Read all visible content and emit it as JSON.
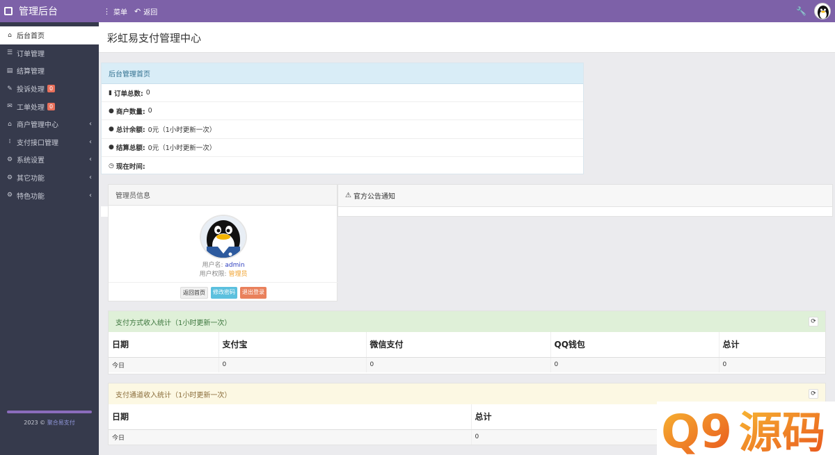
{
  "topbar": {
    "brand": "管理后台",
    "nav": [
      {
        "icon": "⋮",
        "label": "菜单"
      },
      {
        "icon": "↶",
        "label": "返回"
      }
    ]
  },
  "sidebar": {
    "items": [
      {
        "icon": "⌂",
        "label": "后台首页",
        "badge": "",
        "arrow": false
      },
      {
        "icon": "☰",
        "label": "订单管理",
        "badge": "",
        "arrow": false
      },
      {
        "icon": "▤",
        "label": "结算管理",
        "badge": "",
        "arrow": false
      },
      {
        "icon": "✎",
        "label": "投诉处理",
        "badge": "0",
        "arrow": false
      },
      {
        "icon": "✉",
        "label": "工单处理",
        "badge": "0",
        "arrow": false
      },
      {
        "icon": "⌂",
        "label": "商户管理中心",
        "badge": "",
        "arrow": true
      },
      {
        "icon": "⁞",
        "label": "支付接口管理",
        "badge": "",
        "arrow": true
      },
      {
        "icon": "⚙",
        "label": "系统设置",
        "badge": "",
        "arrow": true
      },
      {
        "icon": "⚙",
        "label": "其它功能",
        "badge": "",
        "arrow": true
      },
      {
        "icon": "⚙",
        "label": "特色功能",
        "badge": "",
        "arrow": true
      }
    ],
    "footer_year": "2023 ©",
    "footer_link": "聚合易支付"
  },
  "page": {
    "title": "彩虹易支付管理中心"
  },
  "overview": {
    "heading": "后台管理首页",
    "rows": [
      {
        "icon": "▮",
        "label": "订单总数:",
        "value": "0"
      },
      {
        "icon": "●",
        "label": "商户数量:",
        "value": "0"
      },
      {
        "icon": "●",
        "label": "总计余额:",
        "value": "0元（1小时更新一次）"
      },
      {
        "icon": "●",
        "label": "结算总额:",
        "value": "0元（1小时更新一次）"
      },
      {
        "icon": "◷",
        "label": "现在时间:",
        "value": ""
      }
    ]
  },
  "admin": {
    "heading": "管理员信息",
    "username_label": "用户名:",
    "username": "admin",
    "role_label": "用户权限:",
    "role": "管理员",
    "buttons": [
      "返回首页",
      "修改密码",
      "退出登录"
    ]
  },
  "notice": {
    "icon": "⚠",
    "heading": "官方公告通知"
  },
  "stats_methods": {
    "heading": "支付方式收入统计（1小时更新一次）",
    "columns": [
      "日期",
      "支付宝",
      "微信支付",
      "QQ钱包",
      "总计"
    ],
    "rows": [
      [
        "今日",
        "0",
        "0",
        "0",
        "0"
      ]
    ]
  },
  "stats_channels": {
    "heading": "支付通道收入统计（1小时更新一次）",
    "columns": [
      "日期",
      "总计"
    ],
    "rows": [
      [
        "今日",
        "0"
      ]
    ]
  },
  "watermark": "Q9源码"
}
